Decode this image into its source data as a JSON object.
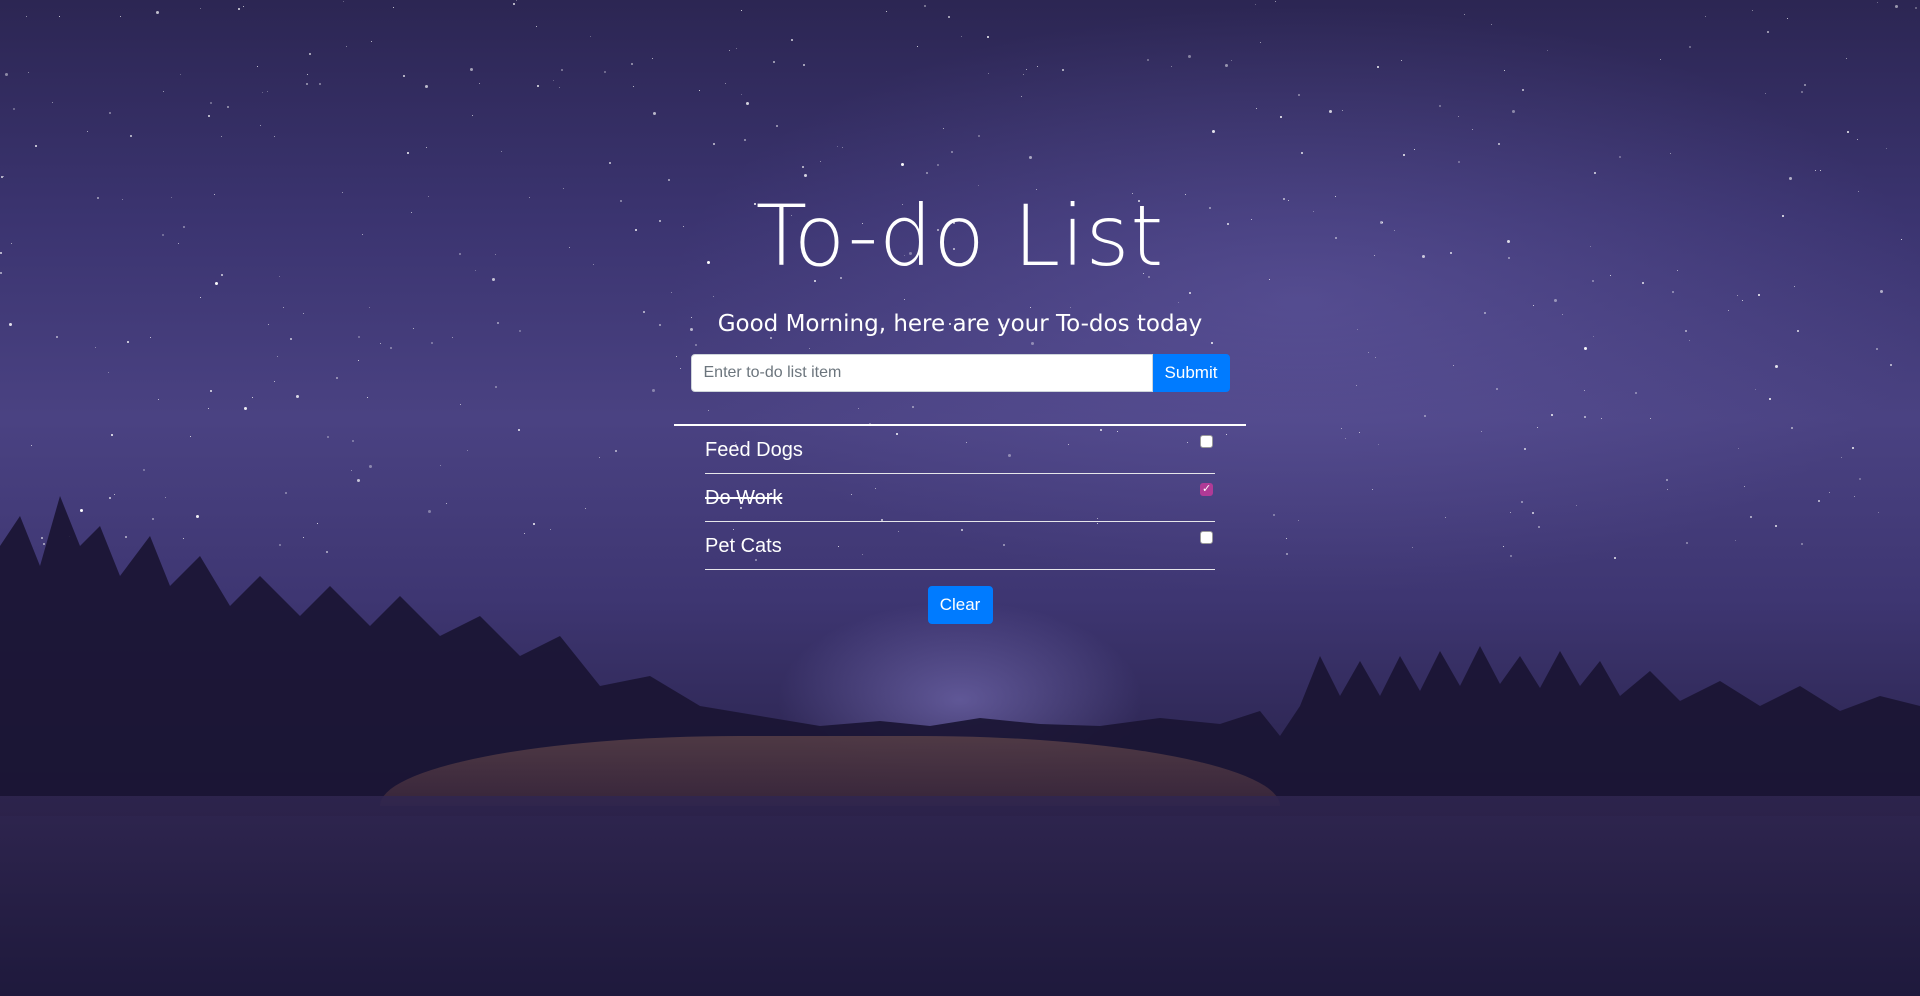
{
  "header": {
    "title": "To-do List",
    "subtitle": "Good Morning, here are your To-dos today"
  },
  "form": {
    "input_placeholder": "Enter to-do list item",
    "input_value": "",
    "submit_label": "Submit"
  },
  "todos": [
    {
      "text": "Feed Dogs",
      "done": false
    },
    {
      "text": "Do Work",
      "done": true
    },
    {
      "text": "Pet Cats",
      "done": false
    }
  ],
  "actions": {
    "clear_label": "Clear"
  },
  "colors": {
    "primary_button": "#007bff",
    "checked_box": "#b03a96",
    "text": "#ffffff"
  }
}
